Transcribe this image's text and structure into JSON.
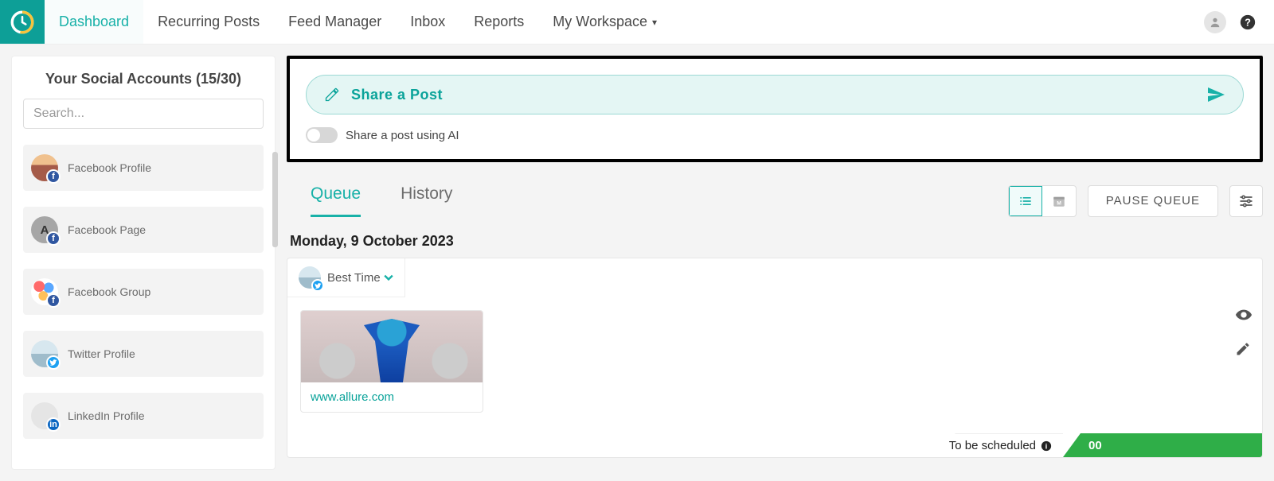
{
  "nav": {
    "items": [
      "Dashboard",
      "Recurring Posts",
      "Feed Manager",
      "Inbox",
      "Reports",
      "My Workspace"
    ],
    "active": 0
  },
  "sidebar": {
    "title": "Your Social Accounts (15/30)",
    "search_placeholder": "Search...",
    "accounts": [
      {
        "label": "Facebook Profile",
        "network": "fb",
        "avatar": "sunset"
      },
      {
        "label": "Facebook Page",
        "network": "fb",
        "avatar": "letter",
        "letter": "A"
      },
      {
        "label": "Facebook Group",
        "network": "fb",
        "avatar": "group"
      },
      {
        "label": "Twitter Profile",
        "network": "tw",
        "avatar": "person"
      },
      {
        "label": "LinkedIn Profile",
        "network": "ln",
        "avatar": "blank"
      }
    ]
  },
  "compose": {
    "share_label": "Share a Post",
    "ai_label": "Share a post using AI",
    "ai_enabled": false
  },
  "tabs": {
    "items": [
      "Queue",
      "History"
    ],
    "active": 0,
    "pause_label": "PAUSE QUEUE"
  },
  "queue": {
    "date": "Monday, 9 October 2023",
    "best_time_label": "Best Time",
    "post": {
      "link_text": "www.allure.com"
    },
    "to_be_scheduled_label": "To be scheduled",
    "count": "00"
  },
  "colors": {
    "accent": "#18b1a8",
    "green": "#2fae48"
  }
}
